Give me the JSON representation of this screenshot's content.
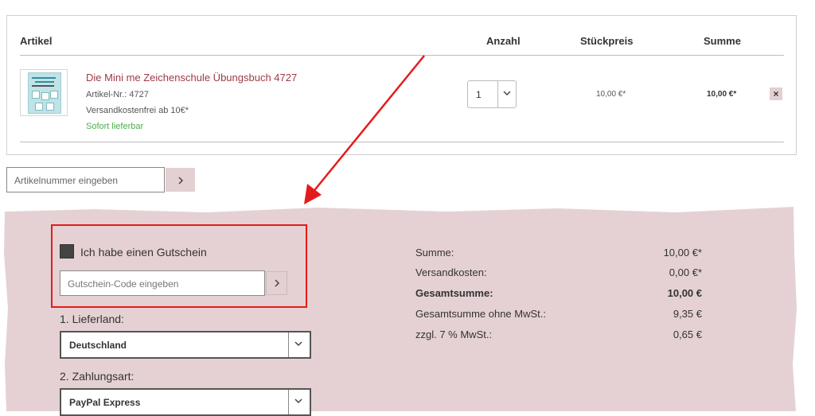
{
  "cart": {
    "headers": {
      "article": "Artikel",
      "quantity": "Anzahl",
      "unit_price": "Stückpreis",
      "total": "Summe"
    },
    "item": {
      "title": "Die Mini me Zeichenschule Übungsbuch 4727",
      "article_no": "Artikel-Nr.: 4727",
      "shipping_note": "Versandkostenfrei ab 10€*",
      "availability": "Sofort lieferbar",
      "quantity": "1",
      "unit_price": "10,00 €*",
      "line_total": "10,00 €*",
      "remove_icon": "×"
    }
  },
  "article_number_input": {
    "placeholder": "Artikelnummer eingeben",
    "button": "›"
  },
  "voucher": {
    "checkbox_label": "Ich habe einen Gutschein",
    "placeholder": "Gutschein-Code eingeben",
    "button": "›"
  },
  "delivery_country": {
    "label": "1. Lieferland:",
    "value": "Deutschland",
    "chevron": "⌄"
  },
  "payment_method": {
    "label": "2. Zahlungsart:",
    "value": "PayPal Express",
    "chevron": "⌄"
  },
  "totals": {
    "sum_label": "Summe:",
    "sum_value": "10,00 €*",
    "shipping_label": "Versandkosten:",
    "shipping_value": "0,00 €*",
    "grand_label": "Gesamtsumme:",
    "grand_value": "10,00 €",
    "net_label": "Gesamtsumme ohne MwSt.:",
    "net_value": "9,35 €",
    "vat_label": "zzgl. 7 % MwSt.:",
    "vat_value": "0,65 €"
  },
  "colors": {
    "accent": "#e3d0d2",
    "summary_bg": "#e5d1d3",
    "highlight": "#e41b1b",
    "link": "#9d3a45",
    "stock": "#4cae4c"
  },
  "icons": {
    "arrow": "red-annotation-arrow",
    "chevron": "chevron-down-icon",
    "next": "chevron-right-icon"
  }
}
